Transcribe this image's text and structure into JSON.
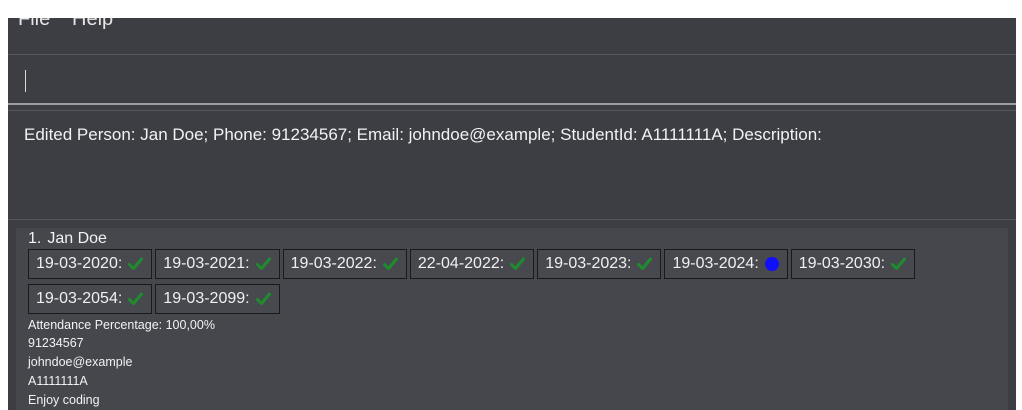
{
  "menu": {
    "file": "File",
    "help": "Help"
  },
  "command_box": {
    "value": "",
    "placeholder": ""
  },
  "result_display": {
    "text": "Edited Person: Jan Doe; Phone: 91234567; Email: johndoe@example; StudentId: A1111111A; Description:"
  },
  "person": {
    "index": "1.",
    "name": "Jan Doe",
    "attendance": [
      {
        "date": "19-03-2020:",
        "status": "present"
      },
      {
        "date": "19-03-2021:",
        "status": "present"
      },
      {
        "date": "19-03-2022:",
        "status": "present"
      },
      {
        "date": "22-04-2022:",
        "status": "present"
      },
      {
        "date": "19-03-2023:",
        "status": "present"
      },
      {
        "date": "19-03-2024:",
        "status": "unmarked"
      },
      {
        "date": "19-03-2030:",
        "status": "present"
      },
      {
        "date": "19-03-2054:",
        "status": "present"
      },
      {
        "date": "19-03-2099:",
        "status": "present"
      }
    ],
    "attendance_percentage": "Attendance Percentage: 100,00%",
    "phone": "91234567",
    "email": "johndoe@example",
    "student_id": "A1111111A",
    "description": "Enjoy coding"
  },
  "colors": {
    "background": "#3c3e44",
    "check": "#1e8c2e",
    "unmarked_dot": "#1010ff"
  },
  "icons": {
    "present": "check-icon",
    "unmarked": "dot-icon"
  }
}
